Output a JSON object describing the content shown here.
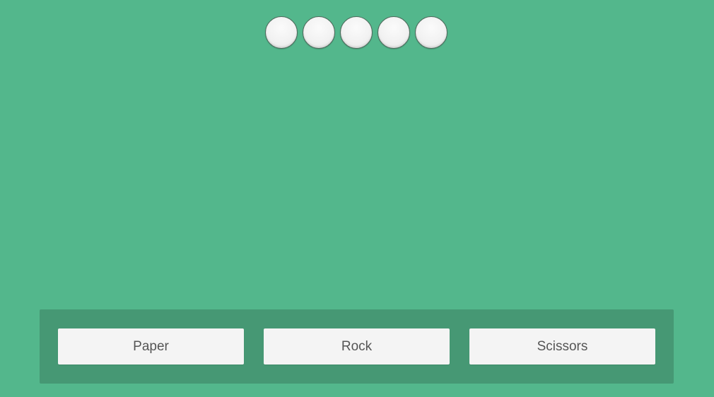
{
  "colors": {
    "background": "#53b78c",
    "tray": "#469874",
    "button": "#f4f4f4",
    "button_text": "#555555"
  },
  "score_tokens": [
    {
      "icon": "empty-circle-icon"
    },
    {
      "icon": "empty-circle-icon"
    },
    {
      "icon": "empty-circle-icon"
    },
    {
      "icon": "empty-circle-icon"
    },
    {
      "icon": "empty-circle-icon"
    }
  ],
  "choices": [
    {
      "label": "Paper"
    },
    {
      "label": "Rock"
    },
    {
      "label": "Scissors"
    }
  ]
}
